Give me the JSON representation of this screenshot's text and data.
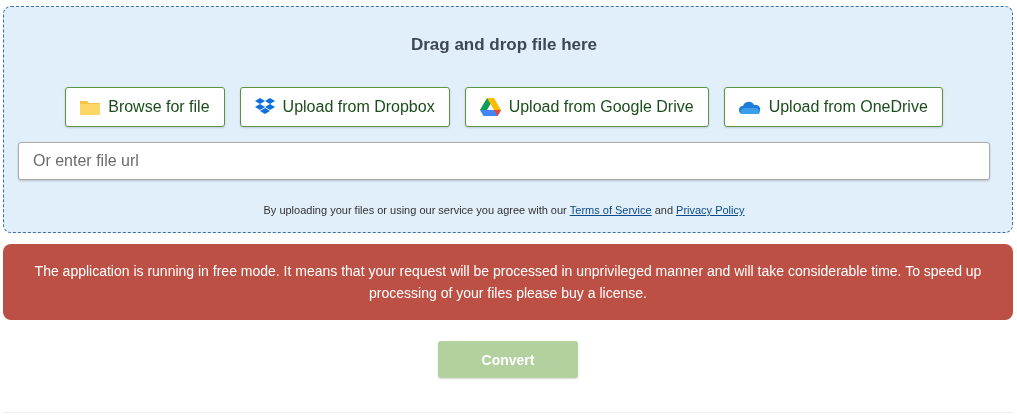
{
  "dropzone": {
    "title": "Drag and drop file here",
    "buttons": [
      {
        "kind": "folder",
        "label": "Browse for file"
      },
      {
        "kind": "dropbox",
        "label": "Upload from Dropbox"
      },
      {
        "kind": "drive",
        "label": "Upload from Google Drive"
      },
      {
        "kind": "cloud",
        "label": "Upload from OneDrive"
      }
    ],
    "url_field": {
      "placeholder": "Or enter file url"
    },
    "terms": {
      "text": "By uploading your files or using our service you agree with our",
      "link_1": "Terms of Service",
      "joiner": "and",
      "link_2": "Privacy Policy"
    }
  },
  "alert": {
    "text": "The application is running in free mode. It means that your request will be processed in unprivileged manner and will take considerable time. To speed up processing of your files please buy a license."
  },
  "convert_button": {
    "label": "Convert",
    "disabled": true
  }
}
